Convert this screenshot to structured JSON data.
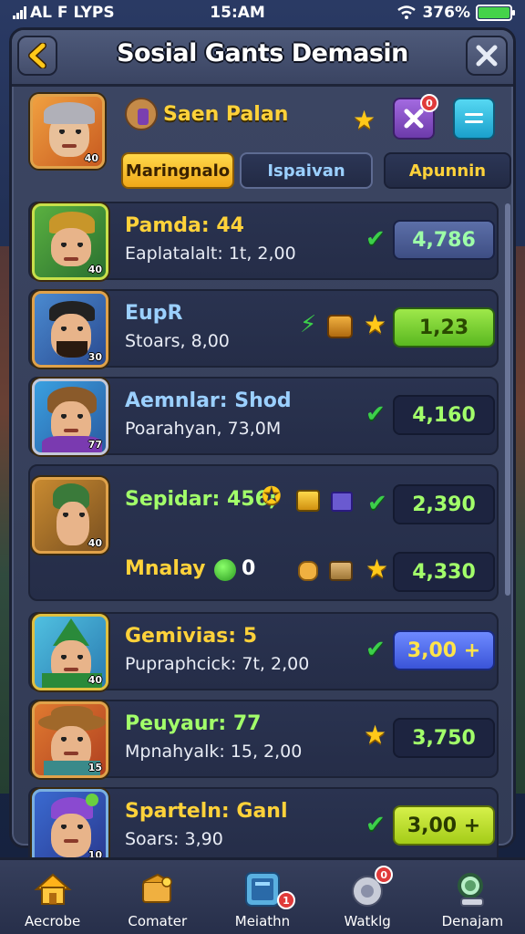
{
  "status_bar": {
    "carrier": "AL F LYPS",
    "time": "15:AM",
    "battery": "376%"
  },
  "header": {
    "title": "Sosial Gants Demasin"
  },
  "profile": {
    "name": "Saen Palan",
    "level": "40",
    "notification_count": "0",
    "tabs": [
      {
        "label": "Maringnalo",
        "active": true
      },
      {
        "label": "Ispaivan",
        "active": false
      },
      {
        "label": "Apunnin",
        "active": false
      }
    ]
  },
  "rows": [
    {
      "name": "Pamda: 44",
      "sub": "Eaplatalalt: 1t, 2,00",
      "level": "40",
      "score": "4,786",
      "icons": [
        "check-icon"
      ],
      "name_color": "#ffd23a",
      "score_style": "navy"
    },
    {
      "name": "EupR",
      "sub": "Stoars, 8,00",
      "level": "30",
      "score": "1,23",
      "icons": [
        "lightning-icon",
        "chest-icon",
        "star-icon"
      ],
      "name_color": "#9bd0ff",
      "score_style": "green"
    },
    {
      "name": "Aemnlar: Shod",
      "sub": "Poarahyan, 73,0M",
      "level": "77",
      "score": "4,160",
      "icons": [
        "check-icon"
      ],
      "name_color": "#9bd0ff",
      "score_style": "dark"
    },
    {
      "name": "Sepidar: 456;",
      "sub": "",
      "level": "40",
      "score": "2,390",
      "icons": [
        "star-icon",
        "badge-icon",
        "gem-icon",
        "check-icon"
      ],
      "name_color": "#a2ff6a",
      "score_style": "dark"
    },
    {
      "name": "Mnalay",
      "sub": "",
      "level": "",
      "score": "4,330",
      "icons": [
        "fist-icon",
        "chest-icon",
        "star-icon"
      ],
      "name_color": "#ffd23a",
      "score_style": "dark",
      "extra": "0"
    },
    {
      "name": "Gemivias: 5",
      "sub": "Pupraphcick: 7t, 2,00",
      "level": "40",
      "score": "3,00 +",
      "icons": [
        "check-icon"
      ],
      "name_color": "#ffd23a",
      "score_style": "blue"
    },
    {
      "name": "Peuyaur: 77",
      "sub": "Mpnahyalk: 15, 2,00",
      "level": "15",
      "score": "3,750",
      "icons": [
        "star-icon"
      ],
      "name_color": "#a2ff6a",
      "score_style": "dark"
    },
    {
      "name": "Sparteln: Ganl",
      "sub": "Soars: 3,90",
      "level": "10",
      "score": "3,00 +",
      "icons": [
        "check-icon"
      ],
      "name_color": "#ffd23a",
      "score_style": "lime"
    }
  ],
  "nav": [
    {
      "label": "Aecrobe",
      "icon": "home-icon"
    },
    {
      "label": "Comater",
      "icon": "mailbox-icon"
    },
    {
      "label": "Meiathn",
      "icon": "book-icon",
      "badge": "1"
    },
    {
      "label": "Watklg",
      "icon": "gear-icon",
      "badge": "0"
    },
    {
      "label": "Denajam",
      "icon": "search-icon"
    }
  ],
  "colors": {
    "accent_gold": "#ffd23a",
    "accent_green": "#3ccf4a",
    "panel": "#3c4663"
  }
}
